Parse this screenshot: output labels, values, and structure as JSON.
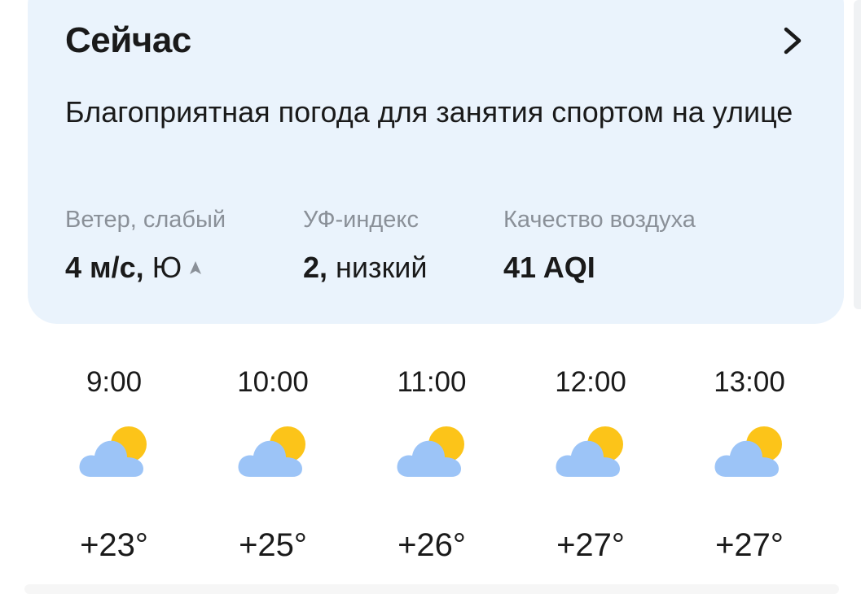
{
  "now": {
    "title": "Сейчас",
    "summary": "Благоприятная погода для занятия спортом на улице",
    "chevron_icon": "chevron-right-icon"
  },
  "metrics": [
    {
      "label": "Ветер, слабый",
      "value_num": "4 м/с,",
      "value_rest": "Ю",
      "icon": "wind-direction-arrow-icon"
    },
    {
      "label": "УФ-индекс",
      "value_num": "2,",
      "value_rest": "низкий"
    },
    {
      "label": "Качество воздуха",
      "value_num": "41 AQI",
      "value_rest": ""
    }
  ],
  "hourly": [
    {
      "time": "9:00",
      "temp": "+23°",
      "icon": "partly-cloudy-icon"
    },
    {
      "time": "10:00",
      "temp": "+25°",
      "icon": "partly-cloudy-icon"
    },
    {
      "time": "11:00",
      "temp": "+26°",
      "icon": "partly-cloudy-icon"
    },
    {
      "time": "12:00",
      "temp": "+27°",
      "icon": "partly-cloudy-icon"
    },
    {
      "time": "13:00",
      "temp": "+27°",
      "icon": "partly-cloudy-icon"
    }
  ],
  "colors": {
    "card_bg": "#eaf3fc",
    "sun": "#fcc419",
    "cloud": "#9cc4f7",
    "muted": "#8a9098"
  }
}
